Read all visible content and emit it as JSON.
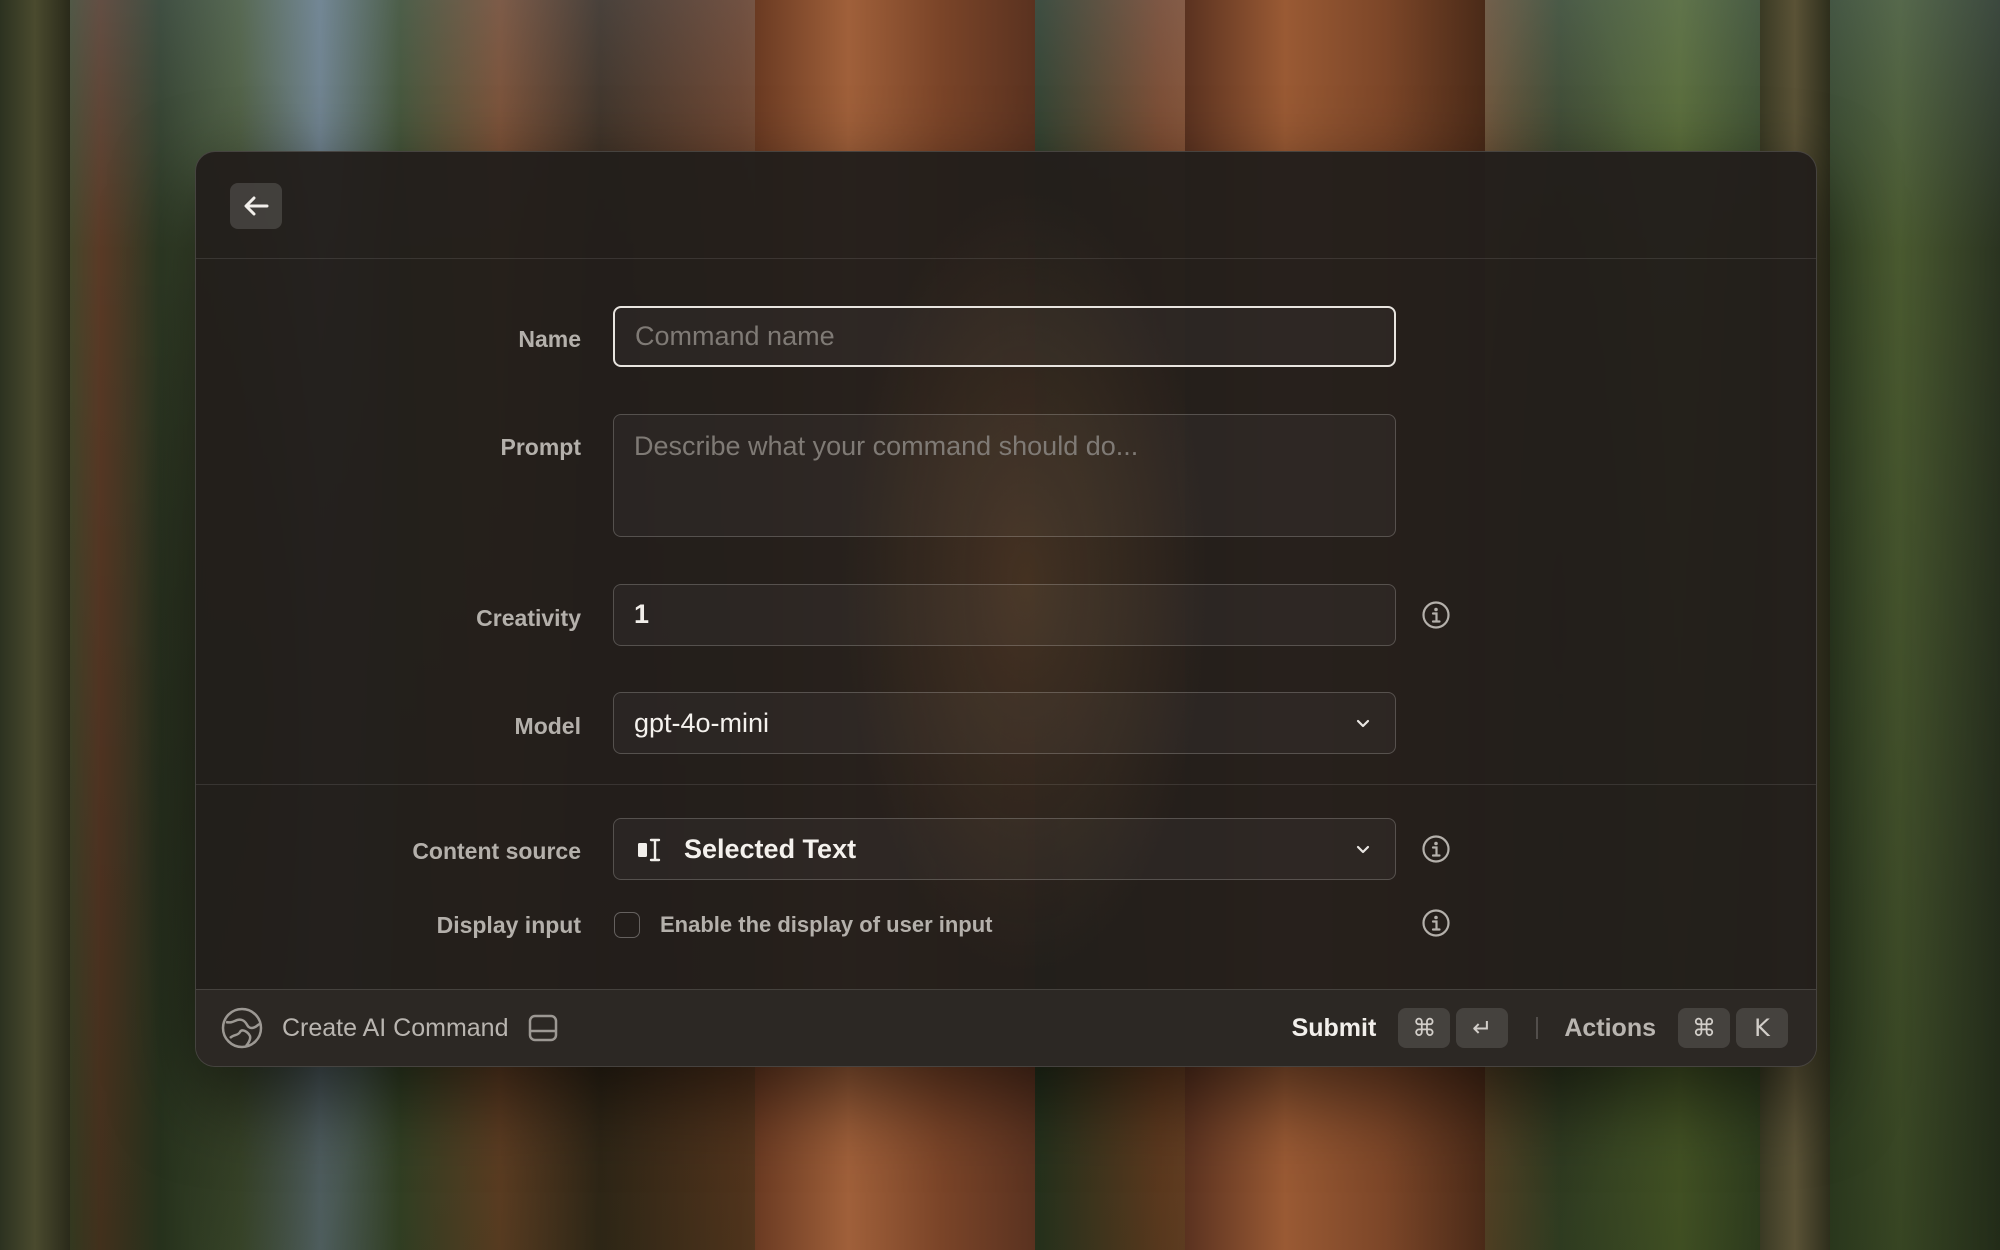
{
  "form": {
    "name": {
      "label": "Name",
      "value": "",
      "placeholder": "Command name"
    },
    "prompt": {
      "label": "Prompt",
      "value": "",
      "placeholder": "Describe what your command should do..."
    },
    "creativity": {
      "label": "Creativity",
      "value": "1"
    },
    "model": {
      "label": "Model",
      "value": "gpt-4o-mini"
    },
    "content_source": {
      "label": "Content source",
      "value": "Selected Text"
    },
    "display_input": {
      "label": "Display input",
      "checkbox_label": "Enable the display of user input",
      "checked": false
    }
  },
  "footer": {
    "title": "Create AI Command",
    "submit": {
      "label": "Submit",
      "keys": [
        "⌘",
        "↵"
      ]
    },
    "actions": {
      "label": "Actions",
      "keys": [
        "⌘",
        "K"
      ]
    }
  },
  "icons": {
    "back": "arrow-left-icon",
    "info": "info-circle-icon",
    "chevron": "chevron-down-icon",
    "content_source": "text-cursor-selection-icon",
    "app": "globe-icon",
    "panel": "panel-bottom-icon"
  }
}
